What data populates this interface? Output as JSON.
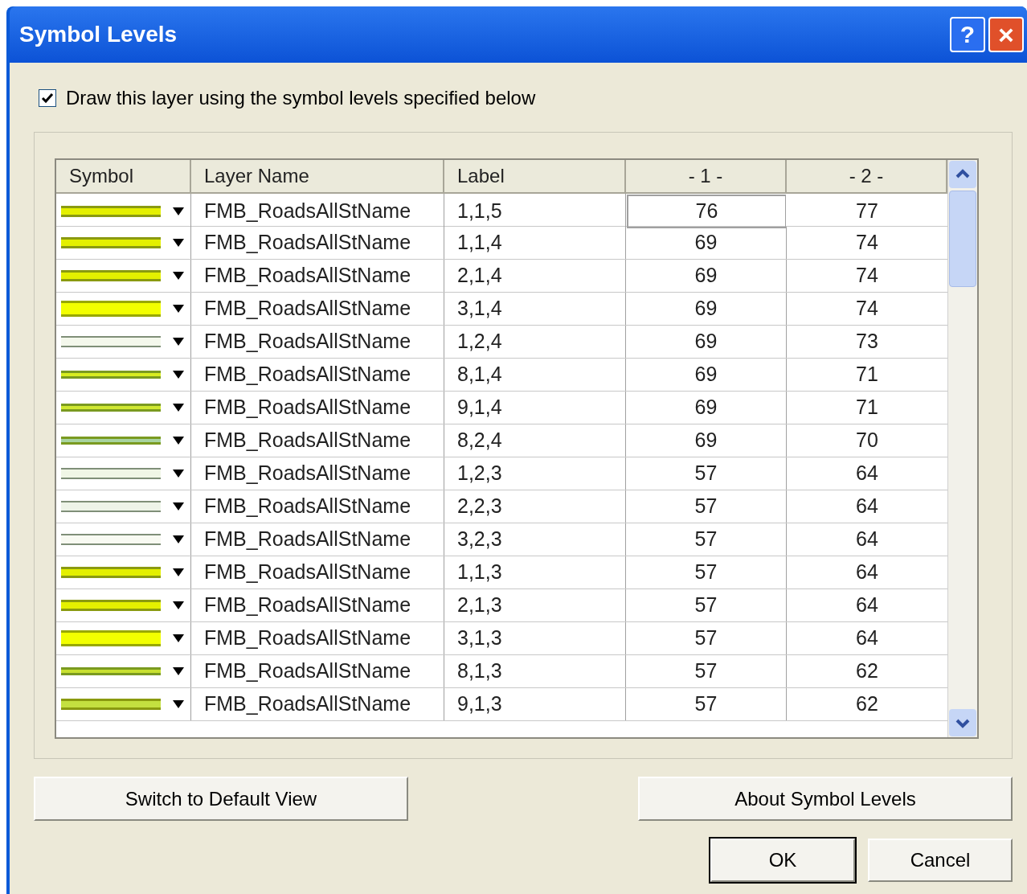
{
  "window": {
    "title": "Symbol Levels",
    "help_button": "?",
    "close_button": "×"
  },
  "checkbox": {
    "label": "Draw this layer using the symbol levels specified below",
    "checked": true
  },
  "table": {
    "columns": [
      "Symbol",
      "Layer Name",
      "Label",
      "- 1 -",
      "- 2 -"
    ],
    "rows": [
      {
        "symbol": {
          "kind": "medium",
          "color": "#e4f000"
        },
        "layer": "FMB_RoadsAllStName",
        "label": "1,1,5",
        "level_1": "76",
        "level_2": "77",
        "selected": true
      },
      {
        "symbol": {
          "kind": "medium",
          "color": "#e4f000"
        },
        "layer": "FMB_RoadsAllStName",
        "label": "1,1,4",
        "level_1": "69",
        "level_2": "74",
        "selected": false
      },
      {
        "symbol": {
          "kind": "medium",
          "color": "#e4f000"
        },
        "layer": "FMB_RoadsAllStName",
        "label": "2,1,4",
        "level_1": "69",
        "level_2": "74",
        "selected": false
      },
      {
        "symbol": {
          "kind": "thick",
          "color": "#f2ff00"
        },
        "layer": "FMB_RoadsAllStName",
        "label": "3,1,4",
        "level_1": "69",
        "level_2": "74",
        "selected": false
      },
      {
        "symbol": {
          "kind": "thin",
          "color": "#f4f8ec"
        },
        "layer": "FMB_RoadsAllStName",
        "label": "1,2,4",
        "level_1": "69",
        "level_2": "73",
        "selected": false
      },
      {
        "symbol": {
          "kind": "narrow",
          "color": "#d8ec20"
        },
        "layer": "FMB_RoadsAllStName",
        "label": "8,1,4",
        "level_1": "69",
        "level_2": "71",
        "selected": false
      },
      {
        "symbol": {
          "kind": "narrow",
          "color": "#d0e830"
        },
        "layer": "FMB_RoadsAllStName",
        "label": "9,1,4",
        "level_1": "69",
        "level_2": "71",
        "selected": false
      },
      {
        "symbol": {
          "kind": "narrow",
          "color": "#a8d4a0"
        },
        "layer": "FMB_RoadsAllStName",
        "label": "8,2,4",
        "level_1": "69",
        "level_2": "70",
        "selected": false
      },
      {
        "symbol": {
          "kind": "thin",
          "color": "#f0f6e6"
        },
        "layer": "FMB_RoadsAllStName",
        "label": "1,2,3",
        "level_1": "57",
        "level_2": "64",
        "selected": false
      },
      {
        "symbol": {
          "kind": "thin",
          "color": "#eef4e8"
        },
        "layer": "FMB_RoadsAllStName",
        "label": "2,2,3",
        "level_1": "57",
        "level_2": "64",
        "selected": false
      },
      {
        "symbol": {
          "kind": "thin",
          "color": "#f8faf2"
        },
        "layer": "FMB_RoadsAllStName",
        "label": "3,2,3",
        "level_1": "57",
        "level_2": "64",
        "selected": false
      },
      {
        "symbol": {
          "kind": "medium",
          "color": "#e4f000"
        },
        "layer": "FMB_RoadsAllStName",
        "label": "1,1,3",
        "level_1": "57",
        "level_2": "64",
        "selected": false
      },
      {
        "symbol": {
          "kind": "medium",
          "color": "#e4f000"
        },
        "layer": "FMB_RoadsAllStName",
        "label": "2,1,3",
        "level_1": "57",
        "level_2": "64",
        "selected": false
      },
      {
        "symbol": {
          "kind": "thick",
          "color": "#f2ff00"
        },
        "layer": "FMB_RoadsAllStName",
        "label": "3,1,3",
        "level_1": "57",
        "level_2": "64",
        "selected": false
      },
      {
        "symbol": {
          "kind": "narrow",
          "color": "#c8e030"
        },
        "layer": "FMB_RoadsAllStName",
        "label": "8,1,3",
        "level_1": "57",
        "level_2": "62",
        "selected": false
      },
      {
        "symbol": {
          "kind": "medium",
          "color": "#c4e040"
        },
        "layer": "FMB_RoadsAllStName",
        "label": "9,1,3",
        "level_1": "57",
        "level_2": "62",
        "selected": false
      }
    ]
  },
  "buttons": {
    "switch_view": "Switch to Default View",
    "about": "About Symbol Levels",
    "ok": "OK",
    "cancel": "Cancel"
  }
}
